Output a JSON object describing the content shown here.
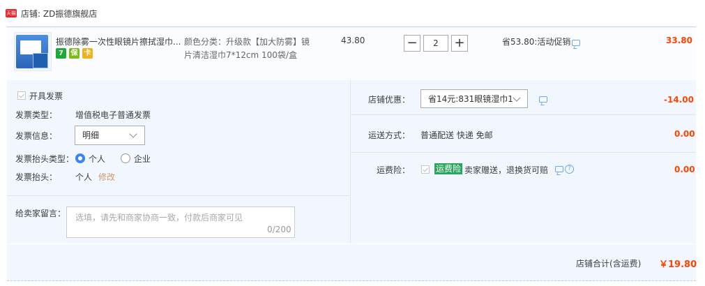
{
  "shop": {
    "badge_text": "天猫",
    "name": "店铺: ZD振德旗舰店"
  },
  "item": {
    "title": "振德除雾一次性眼镜片擦拭湿巾...",
    "service_icons": [
      "7-day-return-icon",
      "insurance-icon",
      "card-icon"
    ],
    "service_labels": [
      "7",
      "保",
      "卡"
    ],
    "sku_lines": [
      "颜色分类：升级款【加大防雾】镜",
      "片清洁湿巾7*12cm 100袋/盒"
    ],
    "unit_price": "43.80",
    "quantity": "2",
    "promo": "省53.80:活动促销",
    "subtotal": "33.80"
  },
  "invoice": {
    "checkbox_label": "开具发票",
    "type_label": "发票类型：",
    "type_value": "增值税电子普通发票",
    "info_label": "发票信息：",
    "info_value": "明细",
    "header_type_label": "发票抬头类型：",
    "header_type_options": [
      {
        "label": "个人",
        "selected": true
      },
      {
        "label": "企业",
        "selected": false
      }
    ],
    "header_label": "发票抬头：",
    "header_value": "个人",
    "modify_label": "修改"
  },
  "message": {
    "label": "给卖家留言：",
    "placeholder": "选填，请先和商家协商一致，付款后商家可见",
    "counter": "0/200"
  },
  "discount": {
    "label": "店铺优惠：",
    "selected": "省14元:831眼镜湿巾1",
    "amount": "-14.00"
  },
  "shipping": {
    "label": "运送方式：",
    "value": "普通配送 快递 免邮",
    "amount": "0.00"
  },
  "insurance": {
    "label": "运费险：",
    "tag": "运费险",
    "desc": "卖家赠送，退换货可赔",
    "amount": "0.00"
  },
  "total": {
    "label": "店铺合计(含运费)",
    "value": "￥19.80"
  },
  "colors": {
    "accent": "#3a86f0",
    "price": "#ff4400",
    "panel": "#f2f7ff",
    "tag_green": "#2aa65a"
  }
}
